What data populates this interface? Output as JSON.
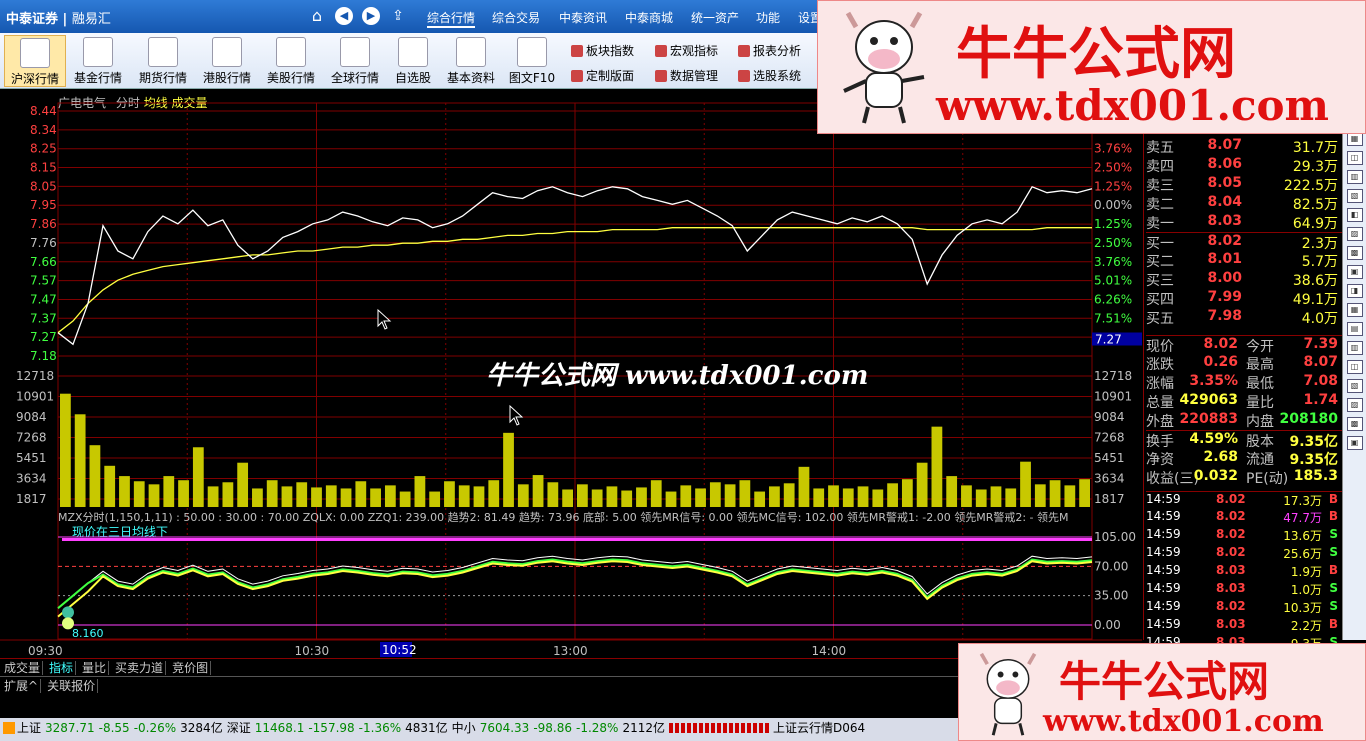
{
  "window": {
    "brand": "中泰证券",
    "sub": "融易汇"
  },
  "menu": [
    "综合行情",
    "综合交易",
    "中泰资讯",
    "中泰商城",
    "统一资产",
    "功能",
    "设置"
  ],
  "toolbar": [
    "沪深行情",
    "基金行情",
    "期货行情",
    "港股行情",
    "美股行情",
    "全球行情",
    "自选股",
    "基本资料",
    "图文F10"
  ],
  "toolbar2": [
    "板块指数",
    "宏观指标",
    "报表分析",
    "定制版面",
    "数据管理",
    "选股系统"
  ],
  "chart_head": {
    "name": "广电电气",
    "mode": "分时",
    "ma": "均线",
    "vol": "成交量"
  },
  "colors": {
    "up": "#ff4040",
    "down": "#40ff40",
    "grid": "#800000",
    "price": "#ffffff",
    "avg": "#ffff40",
    "volume": "#c8c800"
  },
  "chart_data": {
    "type": "line",
    "price_axis": [
      "8.44",
      "8.34",
      "8.25",
      "8.15",
      "8.05",
      "7.95",
      "7.86",
      "7.76",
      "7.66",
      "7.57",
      "7.47",
      "7.37",
      "7.27",
      "7.18"
    ],
    "pct_axis": [
      "6.26%",
      "5.01%",
      "3.76%",
      "2.50%",
      "1.25%",
      "0.00%",
      "1.25%",
      "2.50%",
      "3.76%",
      "5.01%",
      "6.26%",
      "7.51%"
    ],
    "ylim": [
      7.18,
      8.44
    ],
    "prev_close": 7.76,
    "current_tag": "7.27",
    "price": [
      7.3,
      7.24,
      7.45,
      7.85,
      7.72,
      7.68,
      7.82,
      7.9,
      7.86,
      7.93,
      7.85,
      7.88,
      7.75,
      7.68,
      7.72,
      7.79,
      7.82,
      7.86,
      7.88,
      7.92,
      7.9,
      7.87,
      7.85,
      7.89,
      7.88,
      7.84,
      7.86,
      7.9,
      7.96,
      8.02,
      8.0,
      7.99,
      8.03,
      8.05,
      8.02,
      8.0,
      8.03,
      8.05,
      8.04,
      8.0,
      7.98,
      7.96,
      7.98,
      7.94,
      7.9,
      7.85,
      7.72,
      7.8,
      7.88,
      7.92,
      7.9,
      7.88,
      7.86,
      7.89,
      7.87,
      7.9,
      7.86,
      7.78,
      7.55,
      7.7,
      7.8,
      7.86,
      7.88,
      7.86,
      7.92,
      8.05,
      8.02,
      8.03,
      8.02,
      8.04
    ],
    "avg": [
      7.3,
      7.36,
      7.45,
      7.52,
      7.57,
      7.6,
      7.62,
      7.64,
      7.65,
      7.66,
      7.67,
      7.68,
      7.69,
      7.7,
      7.7,
      7.71,
      7.72,
      7.72,
      7.73,
      7.74,
      7.74,
      7.75,
      7.75,
      7.76,
      7.76,
      7.77,
      7.77,
      7.78,
      7.78,
      7.79,
      7.8,
      7.8,
      7.81,
      7.81,
      7.82,
      7.82,
      7.82,
      7.83,
      7.83,
      7.83,
      7.83,
      7.84,
      7.84,
      7.84,
      7.84,
      7.84,
      7.84,
      7.84,
      7.84,
      7.84,
      7.84,
      7.84,
      7.84,
      7.84,
      7.84,
      7.84,
      7.84,
      7.84,
      7.83,
      7.83,
      7.83,
      7.83,
      7.83,
      7.83,
      7.83,
      7.83,
      7.84,
      7.84,
      7.84,
      7.84
    ],
    "vol_axis": [
      "12718",
      "10901",
      "9084",
      "7268",
      "5451",
      "3634",
      "1817"
    ],
    "vol_max": 12718,
    "volume": [
      11000,
      9000,
      6000,
      4000,
      3000,
      2500,
      2200,
      3000,
      2600,
      5800,
      2000,
      2400,
      4300,
      1800,
      2600,
      2000,
      2400,
      1900,
      2100,
      1800,
      2500,
      1800,
      2100,
      1500,
      3000,
      1500,
      2500,
      2100,
      2000,
      2600,
      7200,
      2200,
      3100,
      2400,
      1700,
      2200,
      1700,
      2000,
      1600,
      1900,
      2600,
      1500,
      2100,
      1800,
      2400,
      2200,
      2600,
      1500,
      2000,
      2300,
      3900,
      1800,
      2100,
      1800,
      2000,
      1700,
      2300,
      2700,
      4300,
      7800,
      3000,
      2100,
      1700,
      2000,
      1800,
      4400,
      2200,
      2600,
      2100,
      2700
    ],
    "time_labels": [
      "09:30",
      "10:30",
      "13:00",
      "14:00"
    ],
    "cursor_time": "10:52"
  },
  "indicator": {
    "title": "MZX分时(1,150,1,11) : 50.00 : 30.00 : 70.00 ZQLX: 0.00 ZZQ1: 239.00 趋势2: 81.49 趋势: 73.96 底部: 5.00 领先MR信号: 0.00 领先MC信号: 102.00 领先MR警戒1: -2.00 领先MR警戒2: - 领先M",
    "note": "现价在三日均线下",
    "axis": [
      "105.00",
      "70.00",
      "35.00",
      "0.00"
    ],
    "low": "8.160"
  },
  "quote": {
    "asks": [
      {
        "l": "卖五",
        "p": "8.07",
        "v": "31.7万"
      },
      {
        "l": "卖四",
        "p": "8.06",
        "v": "29.3万"
      },
      {
        "l": "卖三",
        "p": "8.05",
        "v": "222.5万"
      },
      {
        "l": "卖二",
        "p": "8.04",
        "v": "82.5万"
      },
      {
        "l": "卖一",
        "p": "8.03",
        "v": "64.9万"
      }
    ],
    "bids": [
      {
        "l": "买一",
        "p": "8.02",
        "v": "2.3万"
      },
      {
        "l": "买二",
        "p": "8.01",
        "v": "5.7万"
      },
      {
        "l": "买三",
        "p": "8.00",
        "v": "38.6万"
      },
      {
        "l": "买四",
        "p": "7.99",
        "v": "49.1万"
      },
      {
        "l": "买五",
        "p": "7.98",
        "v": "4.0万"
      }
    ],
    "stats": [
      [
        "现价",
        "8.02",
        "今开",
        "7.39"
      ],
      [
        "涨跌",
        "0.26",
        "最高",
        "8.07"
      ],
      [
        "涨幅",
        "3.35%",
        "最低",
        "7.08"
      ],
      [
        "总量",
        "429063",
        "量比",
        "1.74"
      ],
      [
        "外盘",
        "220883",
        "内盘",
        "208180"
      ],
      [
        "换手",
        "4.59%",
        "股本",
        "9.35亿"
      ],
      [
        "净资",
        "2.68",
        "流通",
        "9.35亿"
      ],
      [
        "收益(三)",
        "0.032",
        "PE(动)",
        "185.3"
      ]
    ],
    "ticks": [
      [
        "14:59",
        "8.02",
        "17.3万",
        "B"
      ],
      [
        "14:59",
        "8.02",
        "47.7万",
        "B"
      ],
      [
        "14:59",
        "8.02",
        "13.6万",
        "S"
      ],
      [
        "14:59",
        "8.02",
        "25.6万",
        "S"
      ],
      [
        "14:59",
        "8.03",
        "1.9万",
        "B"
      ],
      [
        "14:59",
        "8.03",
        "1.0万",
        "S"
      ],
      [
        "14:59",
        "8.02",
        "10.3万",
        "S"
      ],
      [
        "14:59",
        "8.03",
        "2.2万",
        "B"
      ],
      [
        "14:59",
        "8.03",
        "9.3万",
        "S"
      ]
    ]
  },
  "tabs1": [
    "成交量",
    "指标",
    "量比",
    "买卖力道",
    "竞价图"
  ],
  "tabs2": [
    "扩展^",
    "关联报价"
  ],
  "status": {
    "sh_label": "上证",
    "sh": "3287.71",
    "sh_chg": "-8.55",
    "sh_pct": "-0.26%",
    "sh_amt": "3284亿",
    "sz_label": "深证",
    "sz": "11468.1",
    "sz_chg": "-157.98",
    "sz_pct": "-1.36%",
    "sz_amt": "4831亿",
    "zx_label": "中小",
    "zx": "7604.33",
    "zx_chg": "-98.86",
    "zx_pct": "-1.28%",
    "zx_amt": "2112亿",
    "cloud": "上证云行情D064"
  },
  "watermark": {
    "cn": "牛牛公式网",
    "url": "www.tdx001.com",
    "center": "牛牛公式网 www.tdx001.com"
  }
}
